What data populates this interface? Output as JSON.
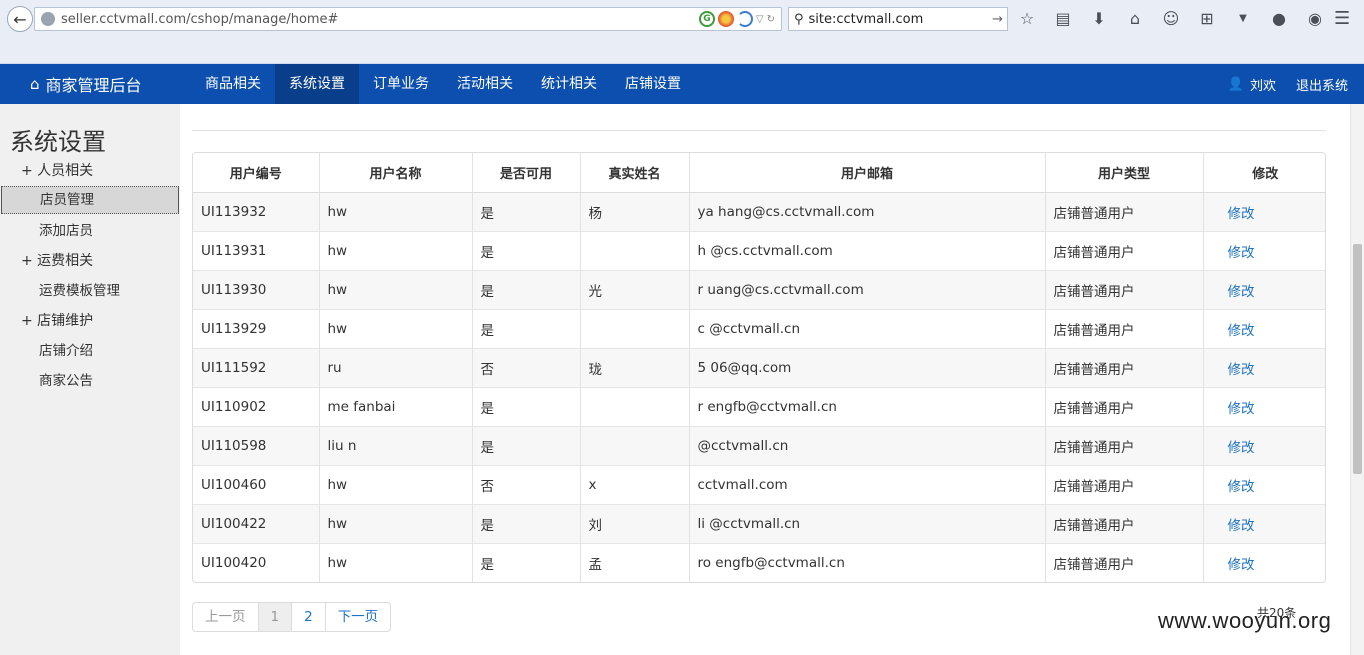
{
  "browser": {
    "url": "seller.cctvmall.com/cshop/manage/home#",
    "search_text": "site:cctvmall.com"
  },
  "appnav": {
    "brand": "商家管理后台",
    "items": [
      "商品相关",
      "系统设置",
      "订单业务",
      "活动相关",
      "统计相关",
      "店铺设置"
    ],
    "active_index": 1,
    "user_name": "刘欢",
    "logout": "退出系统"
  },
  "sidebar": {
    "title": "系统设置",
    "groups": [
      {
        "label": "+ 人员相关",
        "items": [
          "店员管理",
          "添加店员"
        ]
      },
      {
        "label": "+ 运费相关",
        "items": [
          "运费模板管理"
        ]
      },
      {
        "label": "+ 店铺维护",
        "items": [
          "店铺介绍",
          "商家公告"
        ]
      }
    ],
    "active_item": "店员管理"
  },
  "table": {
    "headers": [
      "用户编号",
      "用户名称",
      "是否可用",
      "真实姓名",
      "用户邮箱",
      "用户类型",
      "修改"
    ],
    "rows": [
      [
        "UI113932",
        "hw",
        "是",
        "杨",
        "ya    hang@cs.cctvmall.com",
        "店铺普通用户",
        "修改"
      ],
      [
        "UI113931",
        "hw",
        "是",
        "",
        "h       @cs.cctvmall.com",
        "店铺普通用户",
        "修改"
      ],
      [
        "UI113930",
        "hw",
        "是",
        "    光",
        "r      uang@cs.cctvmall.com",
        "店铺普通用户",
        "修改"
      ],
      [
        "UI113929",
        "hw",
        "是",
        "",
        "c       @cctvmall.cn",
        "店铺普通用户",
        "修改"
      ],
      [
        "UI111592",
        "ru",
        "否",
        "珑",
        "5        06@qq.com",
        "店铺普通用户",
        "修改"
      ],
      [
        "UI110902",
        "me     fanbai",
        "是",
        "",
        "r       engfb@cctvmall.cn",
        "店铺普通用户",
        "修改"
      ],
      [
        "UI110598",
        "liu      n",
        "是",
        "",
        "       @cctvmall.cn",
        "店铺普通用户",
        "修改"
      ],
      [
        "UI100460",
        "hw",
        "否",
        "x",
        "         cctvmall.com",
        "店铺普通用户",
        "修改"
      ],
      [
        "UI100422",
        "hw",
        "是",
        "刘",
        "li       @cctvmall.cn",
        "店铺普通用户",
        "修改"
      ],
      [
        "UI100420",
        "hw",
        "是",
        "孟",
        "ro      engfb@cctvmall.cn",
        "店铺普通用户",
        "修改"
      ]
    ]
  },
  "pager": {
    "prev": "上一页",
    "pages": [
      "1",
      "2"
    ],
    "current": "1",
    "next": "下一页",
    "total": "共20条"
  },
  "watermark": "www.wooyun.org"
}
